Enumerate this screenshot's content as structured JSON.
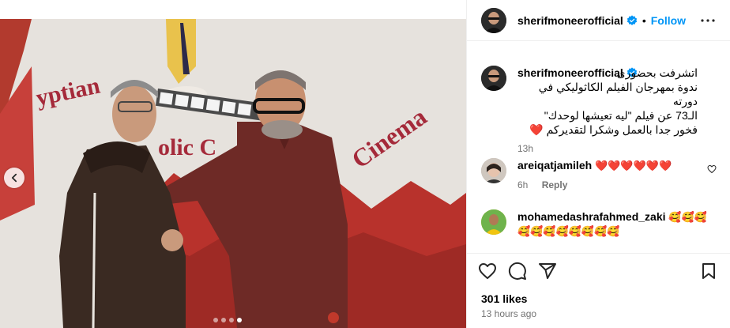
{
  "header": {
    "username": "sherifmoneerofficial",
    "separator": "•",
    "follow_label": "Follow"
  },
  "caption": {
    "username": "sherifmoneerofficial",
    "lines": [
      "اتشرفت بحضورى",
      "ندوة بمهرجان الفيلم الكاثوليكي في دورته",
      "الـ73 عن فيلم \"ليه تعيشها لوحدك\"",
      "فخور جدا بالعمل وشكرا لتقديركم ❤️"
    ],
    "time": "13h"
  },
  "comments": [
    {
      "username": "areiqatjamileh",
      "text": "❤️❤️❤️❤️❤️❤️",
      "time": "6h",
      "reply_label": "Reply"
    },
    {
      "username": "mohamedashrafahmed_zaki",
      "text_line1": "🥰🥰🥰",
      "text_line2": "🥰🥰🥰🥰🥰🥰🥰🥰"
    }
  ],
  "post": {
    "likes": "301 likes",
    "time_ago": "13 hours ago"
  },
  "media": {
    "carousel_total": 4,
    "carousel_active_index": 4,
    "sign_text_left": "yptian",
    "sign_text_mid": "olic C",
    "sign_text_right": "Cinema"
  },
  "colors": {
    "accent": "#0095f6",
    "heart": "#ed4956",
    "muted": "#737373",
    "divider": "#efefef"
  },
  "icons": [
    "verified-badge-icon",
    "more-options-icon",
    "heart-icon",
    "comment-icon",
    "share-icon",
    "bookmark-icon",
    "chevron-left-icon"
  ]
}
